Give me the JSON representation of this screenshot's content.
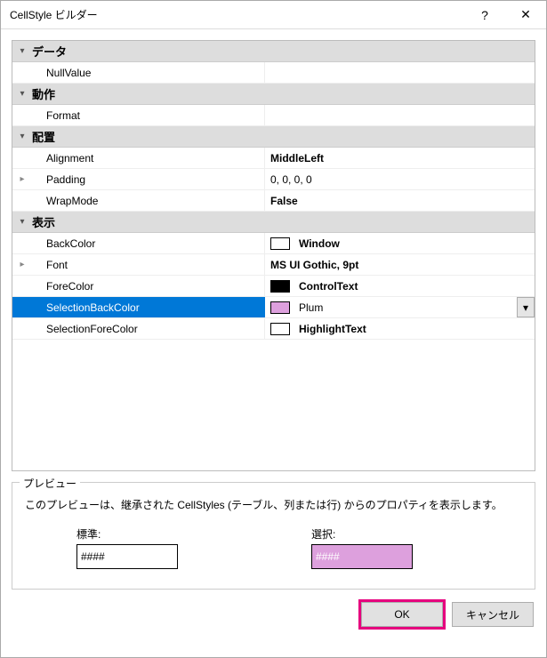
{
  "window": {
    "title": "CellStyle ビルダー",
    "help": "?",
    "close": "✕"
  },
  "categories": {
    "data": {
      "label": "データ"
    },
    "behavior": {
      "label": "動作"
    },
    "layout": {
      "label": "配置"
    },
    "appearance": {
      "label": "表示"
    }
  },
  "props": {
    "nullValue": {
      "name": "NullValue",
      "value": ""
    },
    "format": {
      "name": "Format",
      "value": ""
    },
    "alignment": {
      "name": "Alignment",
      "value": "MiddleLeft"
    },
    "padding": {
      "name": "Padding",
      "value": "0, 0, 0, 0"
    },
    "wrapMode": {
      "name": "WrapMode",
      "value": "False"
    },
    "backColor": {
      "name": "BackColor",
      "value": "Window",
      "swatch": "#ffffff"
    },
    "font": {
      "name": "Font",
      "value": "MS UI Gothic, 9pt"
    },
    "foreColor": {
      "name": "ForeColor",
      "value": "ControlText",
      "swatch": "#000000"
    },
    "selectionBackColor": {
      "name": "SelectionBackColor",
      "value": "Plum",
      "swatch": "#dda0dd"
    },
    "selectionForeColor": {
      "name": "SelectionForeColor",
      "value": "HighlightText",
      "swatch": "#ffffff"
    }
  },
  "preview": {
    "legend": "プレビュー",
    "description": "このプレビューは、継承された CellStyles (テーブル、列または行) からのプロパティを表示します。",
    "normalLabel": "標準:",
    "selectedLabel": "選択:",
    "sampleText": "####"
  },
  "buttons": {
    "ok": "OK",
    "cancel": "キャンセル"
  }
}
